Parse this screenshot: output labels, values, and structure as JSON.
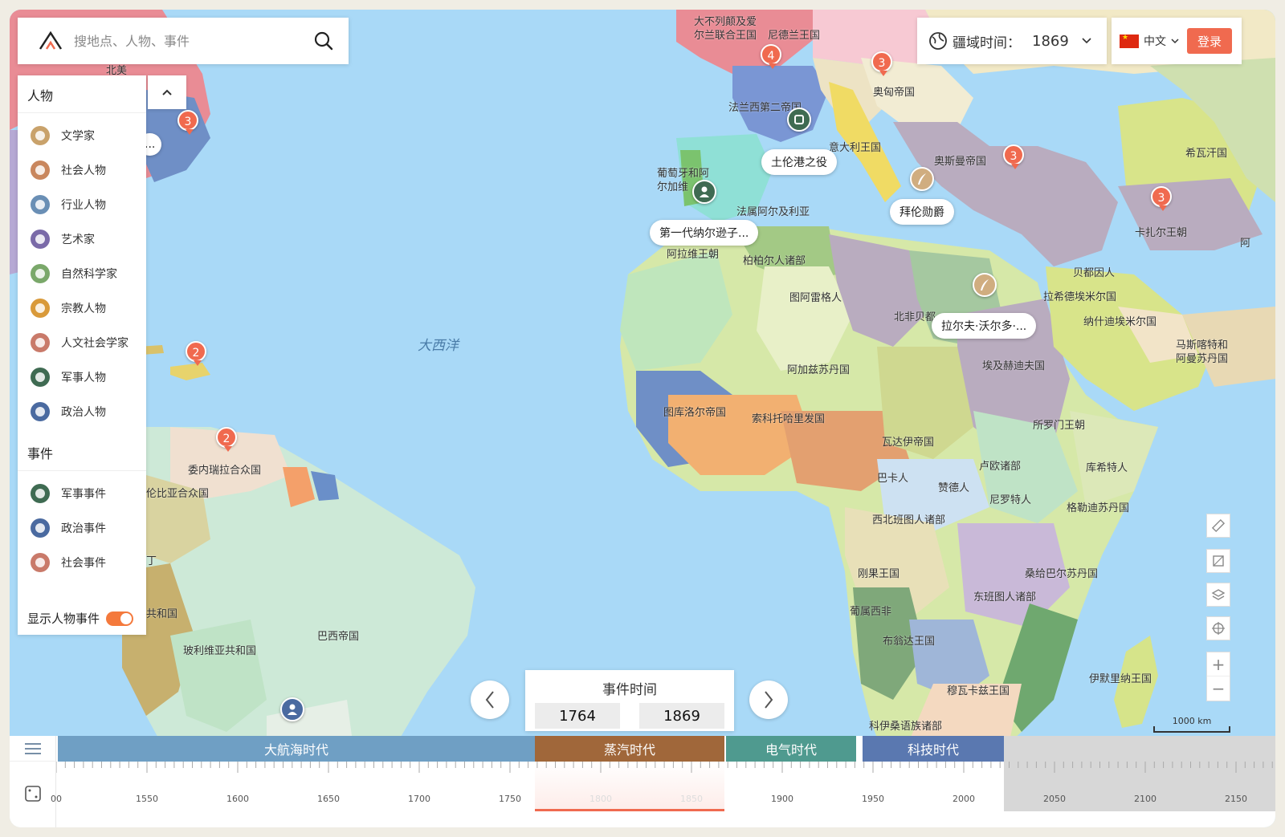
{
  "search": {
    "placeholder": "搜地点、人物、事件"
  },
  "panel": {
    "people_title": "人物",
    "people": [
      {
        "label": "文学家",
        "icon": "quill-icon",
        "color": "#c9a26b"
      },
      {
        "label": "社会人物",
        "icon": "broadcast-icon",
        "color": "#c9875e"
      },
      {
        "label": "行业人物",
        "icon": "briefcase-icon",
        "color": "#6a8fb5"
      },
      {
        "label": "艺术家",
        "icon": "palette-icon",
        "color": "#7a6aa8"
      },
      {
        "label": "自然科学家",
        "icon": "leaf-icon",
        "color": "#7aa86a"
      },
      {
        "label": "宗教人物",
        "icon": "religion-icon",
        "color": "#d99a3a"
      },
      {
        "label": "人文社会学家",
        "icon": "scholar-icon",
        "color": "#c97a6a"
      },
      {
        "label": "军事人物",
        "icon": "soldier-icon",
        "color": "#3f6b52"
      },
      {
        "label": "政治人物",
        "icon": "politician-icon",
        "color": "#4a6aa0"
      }
    ],
    "events_title": "事件",
    "events": [
      {
        "label": "军事事件",
        "icon": "military-event-icon",
        "color": "#3f6b52"
      },
      {
        "label": "政治事件",
        "icon": "political-event-icon",
        "color": "#4a6aa0"
      },
      {
        "label": "社会事件",
        "icon": "social-event-icon",
        "color": "#c97a6a"
      }
    ],
    "toggle_label": "显示人物事件",
    "toggle_on": true
  },
  "territory": {
    "label": "疆域时间：",
    "year": "1869"
  },
  "language": {
    "label": "中文",
    "login": "登录"
  },
  "event_time": {
    "title": "事件时间",
    "start": "1764",
    "end": "1869"
  },
  "scale": {
    "label": "1000 km"
  },
  "eras": [
    {
      "label": "大航海时代",
      "color": "#6f9fc4"
    },
    {
      "label": "蒸汽时代",
      "color": "#a0673a"
    },
    {
      "label": "电气时代",
      "color": "#4f9a8f"
    },
    {
      "label": "科技时代",
      "color": "#5a78b0"
    }
  ],
  "timeline_ticks": [
    "00",
    "1550",
    "1600",
    "1650",
    "1700",
    "1750",
    "1800",
    "1850",
    "1900",
    "1950",
    "2000",
    "2050",
    "2100",
    "2150"
  ],
  "map": {
    "ocean_label": "大西洋",
    "labels": [
      "大不列颠及爱",
      "尔兰联合王国",
      "尼德兰王国",
      "奥匈帝国",
      "法兰西第二帝国",
      "意大利王国",
      "奥斯曼帝国",
      "希瓦汗国",
      "葡萄牙和阿",
      "尔加维",
      "卡扎尔王朝",
      "法属阿尔及利亚",
      "阿拉维王朝",
      "柏柏尔人诸部",
      "贝都因人",
      "图阿雷格人",
      "拉希德埃米尔国",
      "北非贝都",
      "纳什迪埃米尔国",
      "马斯喀特和",
      "阿曼苏丹国",
      "阿加兹苏丹国",
      "埃及赫迪夫国",
      "图库洛尔帝国",
      "索科托哈里发国",
      "所罗门王朝",
      "瓦达伊帝国",
      "委内瑞拉合众国",
      "伦比亚合众国",
      "巴卡人",
      "卢欧诸部",
      "库希特人",
      "赞德人",
      "尼罗特人",
      "格勒迪苏丹国",
      "西北班图人诸部",
      "刚果王国",
      "桑给巴尔苏丹国",
      "东班图人诸部",
      "葡属西非",
      "布翁达王国",
      "伊默里纳王国",
      "穆瓦卡兹王国",
      "科伊桑语族诸部",
      "共和国",
      "玻利维亚共和国",
      "巴西帝国",
      "北美",
      "丁",
      "阿"
    ],
    "clusters": [
      "3",
      "4",
      "3",
      "3",
      "3",
      "2",
      "2"
    ],
    "bubbles": [
      "土伦港之役",
      "拜伦勋爵",
      "第一代纳尔逊子...",
      "拉尔夫·沃尔多·...",
      "..."
    ]
  }
}
